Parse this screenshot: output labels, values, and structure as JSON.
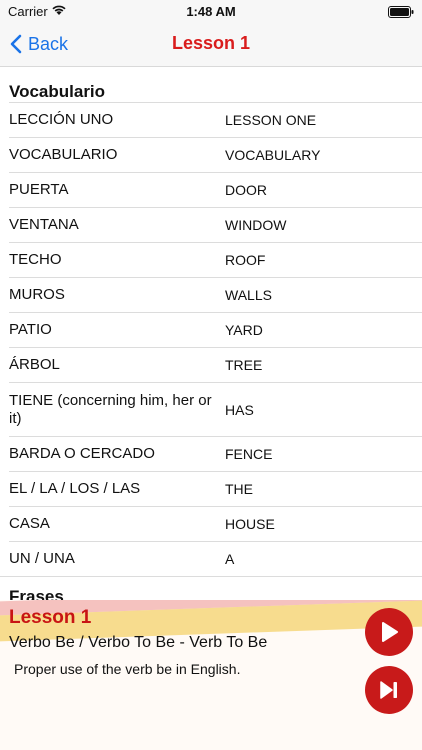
{
  "status": {
    "carrier": "Carrier",
    "time": "1:48 AM"
  },
  "nav": {
    "back_label": "Back",
    "title": "Lesson 1"
  },
  "vocab": {
    "header": "Vocabulario",
    "rows": [
      {
        "es": "LECCIÓN UNO",
        "en": "LESSON ONE"
      },
      {
        "es": "VOCABULARIO",
        "en": "VOCABULARY"
      },
      {
        "es": "PUERTA",
        "en": "DOOR"
      },
      {
        "es": "VENTANA",
        "en": "WINDOW"
      },
      {
        "es": "TECHO",
        "en": "ROOF"
      },
      {
        "es": "MUROS",
        "en": "WALLS"
      },
      {
        "es": "PATIO",
        "en": "YARD"
      },
      {
        "es": "ÁRBOL",
        "en": "TREE"
      },
      {
        "es": "TIENE (concerning him, her or it)",
        "en": "HAS"
      },
      {
        "es": "BARDA O CERCADO",
        "en": "FENCE"
      },
      {
        "es": "EL / LA / LOS / LAS",
        "en": "THE"
      },
      {
        "es": "CASA",
        "en": "HOUSE"
      },
      {
        "es": "UN / UNA",
        "en": "A"
      }
    ]
  },
  "phrases": {
    "header": "Frases"
  },
  "player": {
    "title": "Lesson 1",
    "subtitle": "Verbo Be / Verbo To Be - Verb To Be",
    "description": "Proper use of the verb be in English."
  },
  "colors": {
    "accent_red": "#c81a1a",
    "nav_blue": "#1a73e8"
  }
}
